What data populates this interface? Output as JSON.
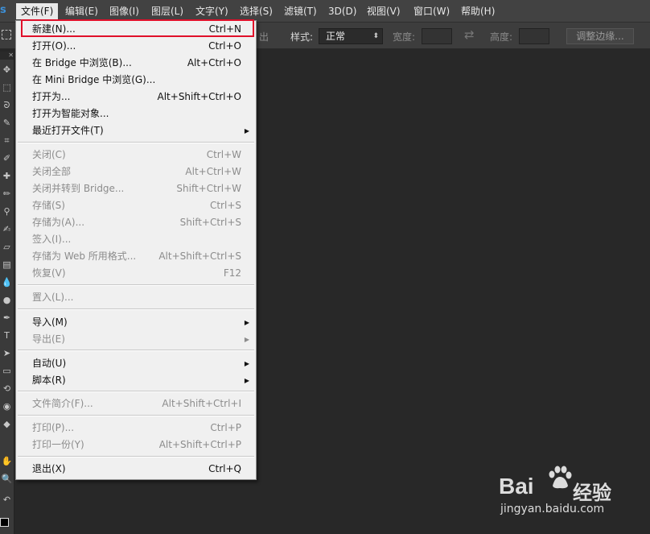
{
  "app": {
    "logo": "s"
  },
  "menubar": {
    "items": [
      "文件(F)",
      "编辑(E)",
      "图像(I)",
      "图层(L)",
      "文字(Y)",
      "选择(S)",
      "滤镜(T)",
      "3D(D)",
      "视图(V)",
      "窗口(W)",
      "帮助(H)"
    ]
  },
  "options_bar": {
    "partial_text": "出",
    "style_label": "样式:",
    "style_value": "正常",
    "width_label": "宽度:",
    "height_label": "高度:",
    "refine_edge_label": "调整边缘..."
  },
  "file_menu": {
    "items": [
      {
        "label": "新建(N)...",
        "shortcut": "Ctrl+N",
        "enabled": true,
        "submenu": false
      },
      {
        "label": "打开(O)...",
        "shortcut": "Ctrl+O",
        "enabled": true,
        "submenu": false
      },
      {
        "label": "在 Bridge 中浏览(B)...",
        "shortcut": "Alt+Ctrl+O",
        "enabled": true,
        "submenu": false
      },
      {
        "label": "在 Mini Bridge 中浏览(G)...",
        "shortcut": "",
        "enabled": true,
        "submenu": false
      },
      {
        "label": "打开为...",
        "shortcut": "Alt+Shift+Ctrl+O",
        "enabled": true,
        "submenu": false
      },
      {
        "label": "打开为智能对象...",
        "shortcut": "",
        "enabled": true,
        "submenu": false
      },
      {
        "label": "最近打开文件(T)",
        "shortcut": "",
        "enabled": true,
        "submenu": true
      },
      {
        "label": "关闭(C)",
        "shortcut": "Ctrl+W",
        "enabled": false,
        "submenu": false
      },
      {
        "label": "关闭全部",
        "shortcut": "Alt+Ctrl+W",
        "enabled": false,
        "submenu": false
      },
      {
        "label": "关闭并转到 Bridge...",
        "shortcut": "Shift+Ctrl+W",
        "enabled": false,
        "submenu": false
      },
      {
        "label": "存储(S)",
        "shortcut": "Ctrl+S",
        "enabled": false,
        "submenu": false
      },
      {
        "label": "存储为(A)...",
        "shortcut": "Shift+Ctrl+S",
        "enabled": false,
        "submenu": false
      },
      {
        "label": "签入(I)...",
        "shortcut": "",
        "enabled": false,
        "submenu": false
      },
      {
        "label": "存储为 Web 所用格式...",
        "shortcut": "Alt+Shift+Ctrl+S",
        "enabled": false,
        "submenu": false
      },
      {
        "label": "恢复(V)",
        "shortcut": "F12",
        "enabled": false,
        "submenu": false
      },
      {
        "label": "置入(L)...",
        "shortcut": "",
        "enabled": false,
        "submenu": false
      },
      {
        "label": "导入(M)",
        "shortcut": "",
        "enabled": true,
        "submenu": true
      },
      {
        "label": "导出(E)",
        "shortcut": "",
        "enabled": false,
        "submenu": true
      },
      {
        "label": "自动(U)",
        "shortcut": "",
        "enabled": true,
        "submenu": true
      },
      {
        "label": "脚本(R)",
        "shortcut": "",
        "enabled": true,
        "submenu": true
      },
      {
        "label": "文件简介(F)...",
        "shortcut": "Alt+Shift+Ctrl+I",
        "enabled": false,
        "submenu": false
      },
      {
        "label": "打印(P)...",
        "shortcut": "Ctrl+P",
        "enabled": false,
        "submenu": false
      },
      {
        "label": "打印一份(Y)",
        "shortcut": "Alt+Shift+Ctrl+P",
        "enabled": false,
        "submenu": false
      },
      {
        "label": "退出(X)",
        "shortcut": "Ctrl+Q",
        "enabled": true,
        "submenu": false
      }
    ],
    "submenu_arrow": "▶"
  },
  "watermark": {
    "brand": "Bai",
    "brand_cn": "经验",
    "url": "jingyan.baidu.com"
  },
  "colors": {
    "highlight": "#e0102a",
    "menu_bg": "#f0f0f0",
    "app_bg": "#262626"
  }
}
